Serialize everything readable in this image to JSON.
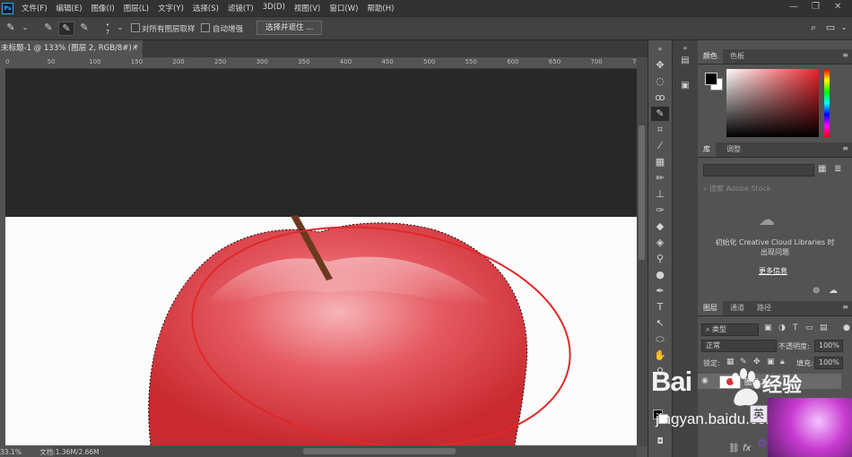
{
  "app": {
    "logo": "Ps"
  },
  "menu": [
    "文件(F)",
    "编辑(E)",
    "图像(I)",
    "图层(L)",
    "文字(Y)",
    "选择(S)",
    "滤镜(T)",
    "3D(D)",
    "视图(V)",
    "窗口(W)",
    "帮助(H)"
  ],
  "options": {
    "brush_size": "7",
    "sample_all_label": "对所有图层取样",
    "auto_enhance_label": "自动增强",
    "select_mask_label": "选择并遮住 ..."
  },
  "document": {
    "tab_title": "未标题-1 @ 133% (图层 2, RGB/8#) *",
    "close": "×"
  },
  "ruler": {
    "h_ticks": [
      "0",
      "50",
      "100",
      "150",
      "200",
      "250",
      "300",
      "350",
      "400",
      "450",
      "500",
      "550",
      "600",
      "650",
      "700",
      "750",
      "80"
    ]
  },
  "status": {
    "zoom": "33.1%",
    "doc": "文档:1.36M/2.66M"
  },
  "color_panel": {
    "tabs": [
      "颜色",
      "色板"
    ],
    "foreground": "#000000",
    "background": "#ffffff",
    "base_hue": "#e8232b"
  },
  "library_panel": {
    "tabs": [
      "库",
      "调整"
    ],
    "search_placeholder": "搜索 Adobe Stock",
    "message": "初始化 Creative Cloud Libraries 时出现问题",
    "more_info": "更多信息"
  },
  "layers_panel": {
    "tabs": [
      "图层",
      "通道",
      "路径"
    ],
    "filter_kind": "类型",
    "blend_mode": "正常",
    "opacity_label": "不透明度:",
    "opacity_value": "100%",
    "lock_label": "锁定:",
    "fill_label": "填充:",
    "fill_value": "100%",
    "layer_name": "图层 2",
    "footer_icons": [
      "link-icon",
      "fx-icon"
    ]
  },
  "watermark": {
    "logo": "Bai",
    "logo_cn": "经验",
    "url": "jingyan.baidu.com",
    "ime": "英"
  },
  "colors": {
    "apple_red": "#d8323a",
    "ellipse": "#e0282a",
    "stem": "#6b3a1e"
  }
}
